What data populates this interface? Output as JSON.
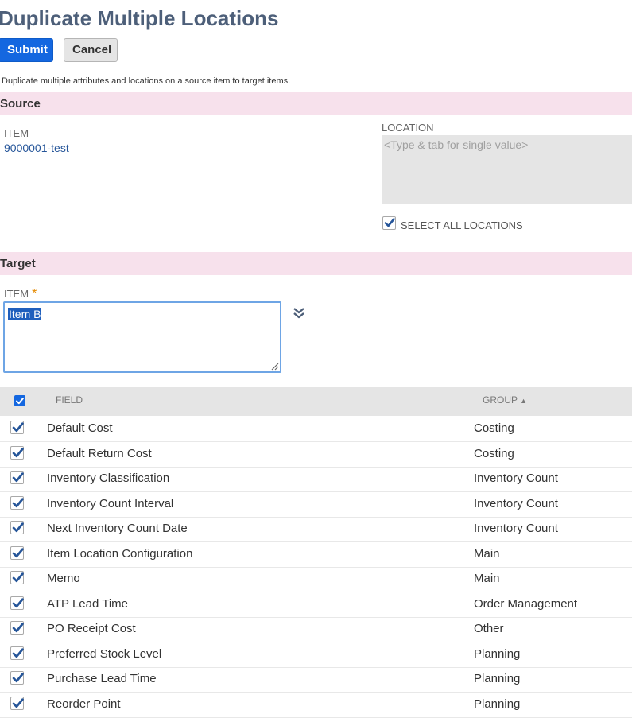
{
  "page": {
    "title": "Duplicate Multiple Locations",
    "submit_label": "Submit",
    "cancel_label": "Cancel",
    "intro": "Duplicate multiple attributes and locations on a source item to target items."
  },
  "source": {
    "section_title": "Source",
    "item_label": "ITEM",
    "item_value": "9000001-test",
    "location_label": "LOCATION",
    "location_placeholder": "<Type & tab for single value>",
    "select_all_label": "SELECT ALL LOCATIONS"
  },
  "target": {
    "section_title": "Target",
    "item_label": "ITEM",
    "required_mark": "*",
    "item_value": "Item B"
  },
  "table": {
    "col_field": "FIELD",
    "col_group": "GROUP",
    "sort_indicator": "▲",
    "rows": [
      {
        "field": "Default Cost",
        "group": "Costing"
      },
      {
        "field": "Default Return Cost",
        "group": "Costing"
      },
      {
        "field": "Inventory Classification",
        "group": "Inventory Count"
      },
      {
        "field": "Inventory Count Interval",
        "group": "Inventory Count"
      },
      {
        "field": "Next Inventory Count Date",
        "group": "Inventory Count"
      },
      {
        "field": "Item Location Configuration",
        "group": "Main"
      },
      {
        "field": "Memo",
        "group": "Main"
      },
      {
        "field": "ATP Lead Time",
        "group": "Order Management"
      },
      {
        "field": "PO Receipt Cost",
        "group": "Other"
      },
      {
        "field": "Preferred Stock Level",
        "group": "Planning"
      },
      {
        "field": "Purchase Lead Time",
        "group": "Planning"
      },
      {
        "field": "Reorder Point",
        "group": "Planning"
      }
    ]
  },
  "colors": {
    "primary": "#1467e0",
    "section_bg": "#f7e1ec",
    "title": "#4d5f79",
    "link": "#255599",
    "checkmark": "#255599"
  }
}
